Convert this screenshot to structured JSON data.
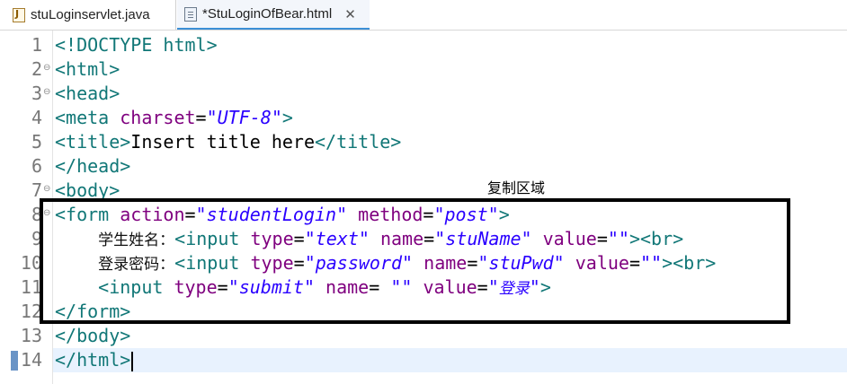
{
  "tabs": [
    {
      "label": "stuLoginservlet.java",
      "icon": "java-file-icon"
    },
    {
      "label": "*StuLoginOfBear.html",
      "icon": "html-file-icon",
      "close": "✕"
    }
  ],
  "editor": {
    "line_numbers": [
      "1",
      "2",
      "3",
      "4",
      "5",
      "6",
      "7",
      "8",
      "9",
      "10",
      "11",
      "12",
      "13",
      "14"
    ],
    "fold_marker": "⊖",
    "line1": "<!DOCTYPE html>",
    "line2": "<html>",
    "line3": "<head>",
    "line4": {
      "tag": "<meta ",
      "attr": "charset",
      "eq": "=",
      "val": "\"UTF-8\"",
      "end": ">"
    },
    "line5": {
      "open": "<title>",
      "text": "Insert title here",
      "close": "</title>"
    },
    "line6": "</head>",
    "line7": "<body>",
    "line8": {
      "tag": "<form ",
      "attr1": "action",
      "eq": "=",
      "val1": "\"studentLogin\"",
      "attr2": " method",
      "val2": "\"post\"",
      "end": ">"
    },
    "line9": {
      "indent": "    ",
      "label": "学生姓名：",
      "tag": "<input ",
      "attr1": "type",
      "eq": "=",
      "val1": "\"text\"",
      "attr2": " name",
      "val2": "\"stuName\"",
      "attr3": " value",
      "val3": "\"\"",
      "end": "><br>"
    },
    "line10": {
      "indent": "    ",
      "label": "登录密码：",
      "tag": "<input ",
      "attr1": "type",
      "eq": "=",
      "val1": "\"password\"",
      "attr2": " name",
      "val2": "\"stuPwd\"",
      "attr3": " value",
      "val3": "\"\"",
      "end": "><br>"
    },
    "line11": {
      "indent": "    ",
      "tag": "<input ",
      "attr1": "type",
      "eq": "=",
      "val1": "\"submit\"",
      "attr2": " name",
      "eq2": "= ",
      "val2": "\"\"",
      "attr3": " value",
      "q1": "\"",
      "val3": "登录",
      "q2": "\"",
      "end": ">"
    },
    "line12": "</form>",
    "line13": "</body>",
    "line14": "</html>"
  },
  "annotation": {
    "label": "复制区域"
  }
}
